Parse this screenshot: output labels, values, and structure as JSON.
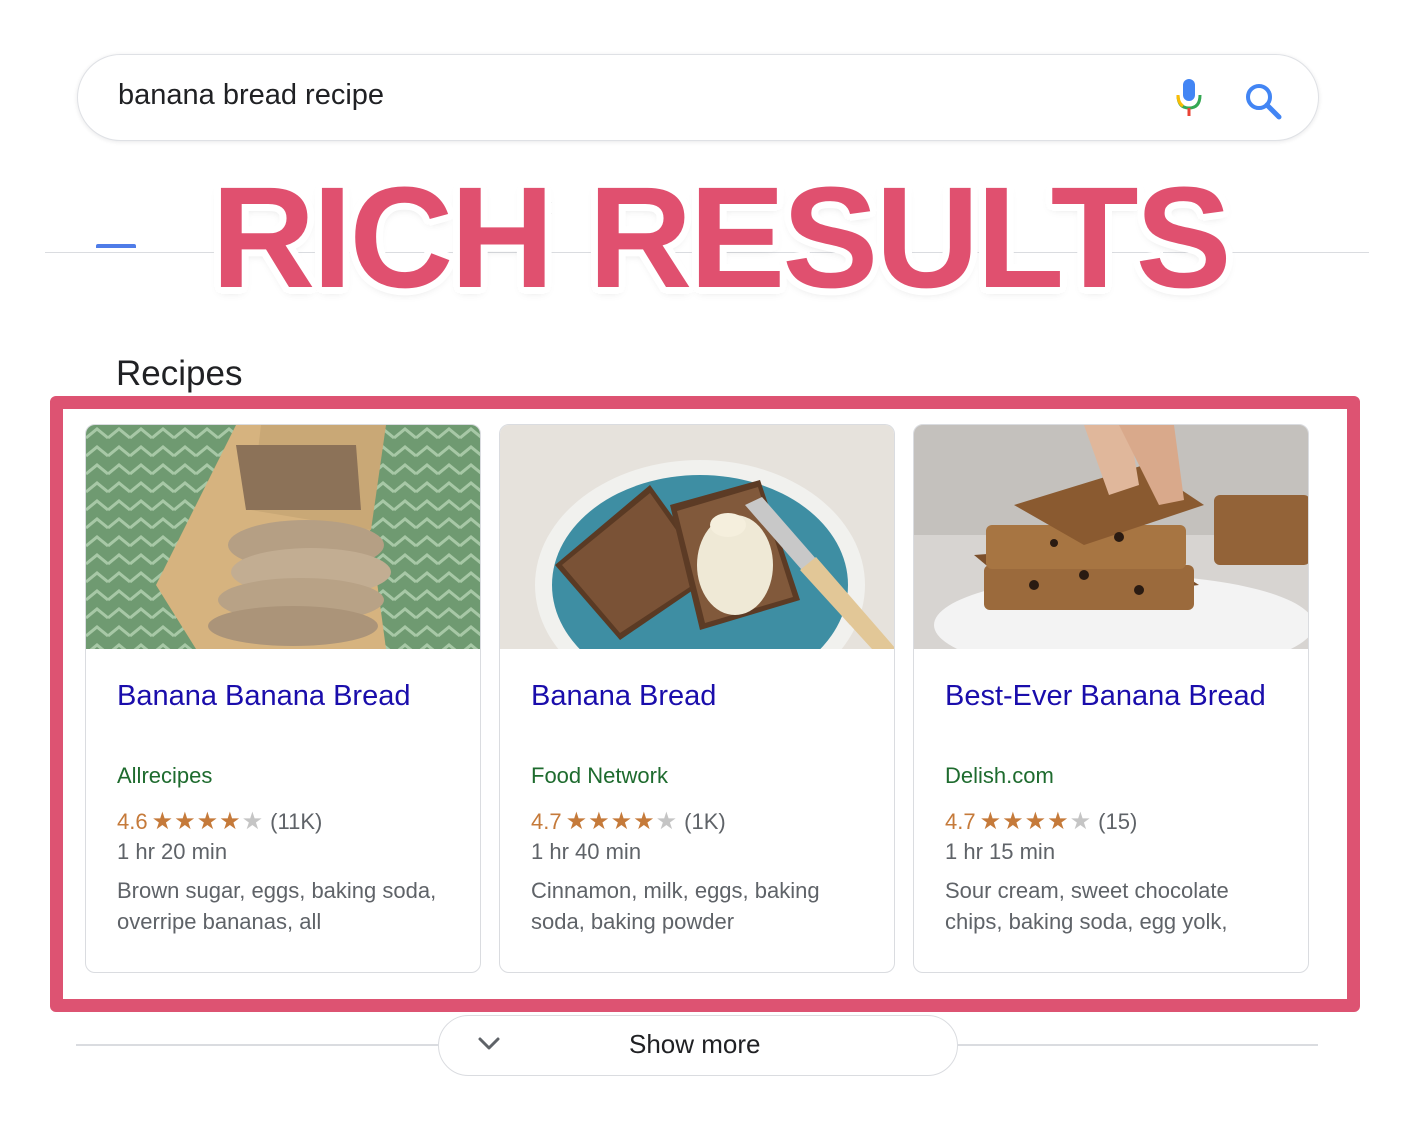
{
  "search": {
    "query": "banana bread recipe",
    "mic_icon": "mic-icon",
    "search_icon": "search-icon"
  },
  "banner": {
    "text": "RICH RESULTS",
    "color": "#e0506f"
  },
  "recipes": {
    "title": "Recipes",
    "highlight_color": "#dd5372",
    "cards": [
      {
        "title": "Banana Banana Bread",
        "source": "Allrecipes",
        "rating": "4.6",
        "rating_value": 4.6,
        "stars_full": "★★★★",
        "stars_part": "★",
        "reviews": "(11K)",
        "time": "1 hr 20 min",
        "ingredients": "Brown sugar, eggs, baking soda, overripe bananas, all"
      },
      {
        "title": "Banana Bread",
        "source": "Food Network",
        "rating": "4.7",
        "rating_value": 4.7,
        "stars_full": "★★★★",
        "stars_part": "★",
        "reviews": "(1K)",
        "time": "1 hr 40 min",
        "ingredients": "Cinnamon, milk, eggs, baking soda, baking powder"
      },
      {
        "title": "Best-Ever Banana Bread",
        "source": "Delish.com",
        "rating": "4.7",
        "rating_value": 4.7,
        "stars_full": "★★★★",
        "stars_part": "★",
        "reviews": "(15)",
        "time": "1 hr 15 min",
        "ingredients": "Sour cream, sweet chocolate chips, baking soda, egg yolk,"
      }
    ]
  },
  "show_more": {
    "label": "Show more",
    "icon": "chevron-down-icon"
  }
}
